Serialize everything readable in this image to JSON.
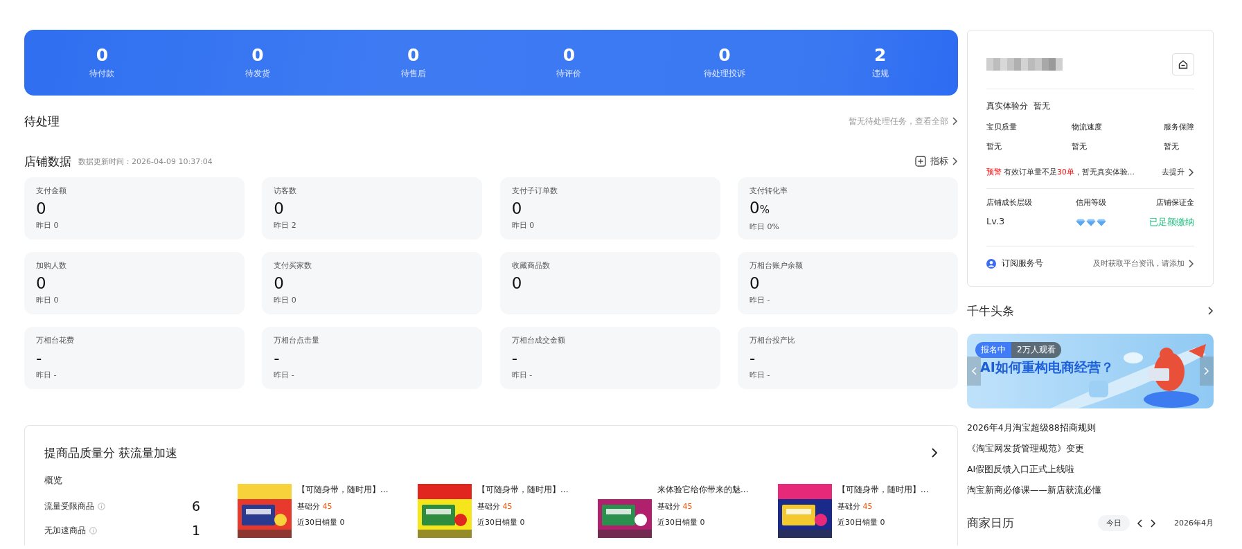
{
  "status_bar": [
    {
      "count": "0",
      "label": "待付款"
    },
    {
      "count": "0",
      "label": "待发货"
    },
    {
      "count": "0",
      "label": "待售后"
    },
    {
      "count": "0",
      "label": "待评价"
    },
    {
      "count": "0",
      "label": "待处理投诉"
    },
    {
      "count": "2",
      "label": "违规"
    }
  ],
  "pending": {
    "title": "待处理",
    "link": "暂无待处理任务，查看全部"
  },
  "shop_data": {
    "title": "店铺数据",
    "updated": "数据更新时间：2026-04-09 10:37:04",
    "metrics_button": "指标",
    "cards": [
      {
        "label": "支付金额",
        "value": "0",
        "yesterday": "昨日 0"
      },
      {
        "label": "访客数",
        "value": "0",
        "yesterday": "昨日 2"
      },
      {
        "label": "支付子订单数",
        "value": "0",
        "yesterday": "昨日 0"
      },
      {
        "label": "支付转化率",
        "value": "0",
        "unit": "%",
        "yesterday": "昨日 0%"
      },
      {
        "label": "加购人数",
        "value": "0",
        "yesterday": "昨日 0"
      },
      {
        "label": "支付买家数",
        "value": "0",
        "yesterday": "昨日 0"
      },
      {
        "label": "收藏商品数",
        "value": "0"
      },
      {
        "label": "万相台账户余额",
        "value": "0",
        "yesterday": "昨日 -"
      },
      {
        "label": "万相台花费",
        "value": "-",
        "yesterday": "昨日 -"
      },
      {
        "label": "万相台点击量",
        "value": "-",
        "yesterday": "昨日 -"
      },
      {
        "label": "万相台成交金额",
        "value": "-",
        "yesterday": "昨日 -"
      },
      {
        "label": "万相台投产比",
        "value": "-",
        "yesterday": "昨日 -"
      }
    ]
  },
  "quality": {
    "title": "提商品质量分 获流量加速",
    "overview": {
      "title": "概览",
      "rows": [
        {
          "label": "流量受限商品",
          "value": "6"
        },
        {
          "label": "无加速商品",
          "value": "1"
        }
      ]
    },
    "products": [
      {
        "title": "【可随身带，随时用】...",
        "score_label": "基础分",
        "score": "45",
        "sales": "近30日销量 0"
      },
      {
        "title": "【可随身带，随时用】...",
        "score_label": "基础分",
        "score": "45",
        "sales": "近30日销量 0"
      },
      {
        "title": "来体验它给你带来的魅...",
        "score_label": "基础分",
        "score": "45",
        "sales": "近30日销量 0"
      },
      {
        "title": "【可随身带，随时用】...",
        "score_label": "基础分",
        "score": "45",
        "sales": "近30日销量 0"
      }
    ]
  },
  "shop_card": {
    "experience": {
      "label": "真实体验分",
      "value": "暂无"
    },
    "scores": [
      {
        "label": "宝贝质量",
        "value": "暂无"
      },
      {
        "label": "物流速度",
        "value": "暂无"
      },
      {
        "label": "服务保障",
        "value": "暂无"
      }
    ],
    "warning": [
      {
        "text": "预警",
        "kind": "alert"
      },
      {
        "text": " 有效订单量不足",
        "kind": "plain"
      },
      {
        "text": "30单",
        "kind": "alert"
      },
      {
        "text": "，暂无真实体验...",
        "kind": "plain"
      }
    ],
    "warning_action": "去提升",
    "levels": [
      {
        "label": "店铺成长层级",
        "kind": "text",
        "value": "Lv.3"
      },
      {
        "label": "信用等级",
        "kind": "diamonds",
        "stars": 3
      },
      {
        "label": "店铺保证金",
        "kind": "success",
        "value": "已足额缴纳"
      }
    ],
    "subscribe": {
      "label": "订阅服务号",
      "hint": "及时获取平台资讯，请添加"
    }
  },
  "headlines": {
    "title": "千牛头条",
    "banner": {
      "tags": [
        {
          "text": "报名中",
          "kind": "primary"
        },
        {
          "text": "2万人观看",
          "kind": "dark"
        }
      ],
      "headline": "AI如何重构电商经营？"
    },
    "news": [
      "2026年4月淘宝超级88招商规则",
      "《淘宝网发货管理规范》变更",
      "AI假图反馈入口正式上线啦",
      "淘宝新商必修课——新店获流必懂"
    ]
  },
  "calendar": {
    "title": "商家日历",
    "today": "今日",
    "month": "2026年4月"
  }
}
